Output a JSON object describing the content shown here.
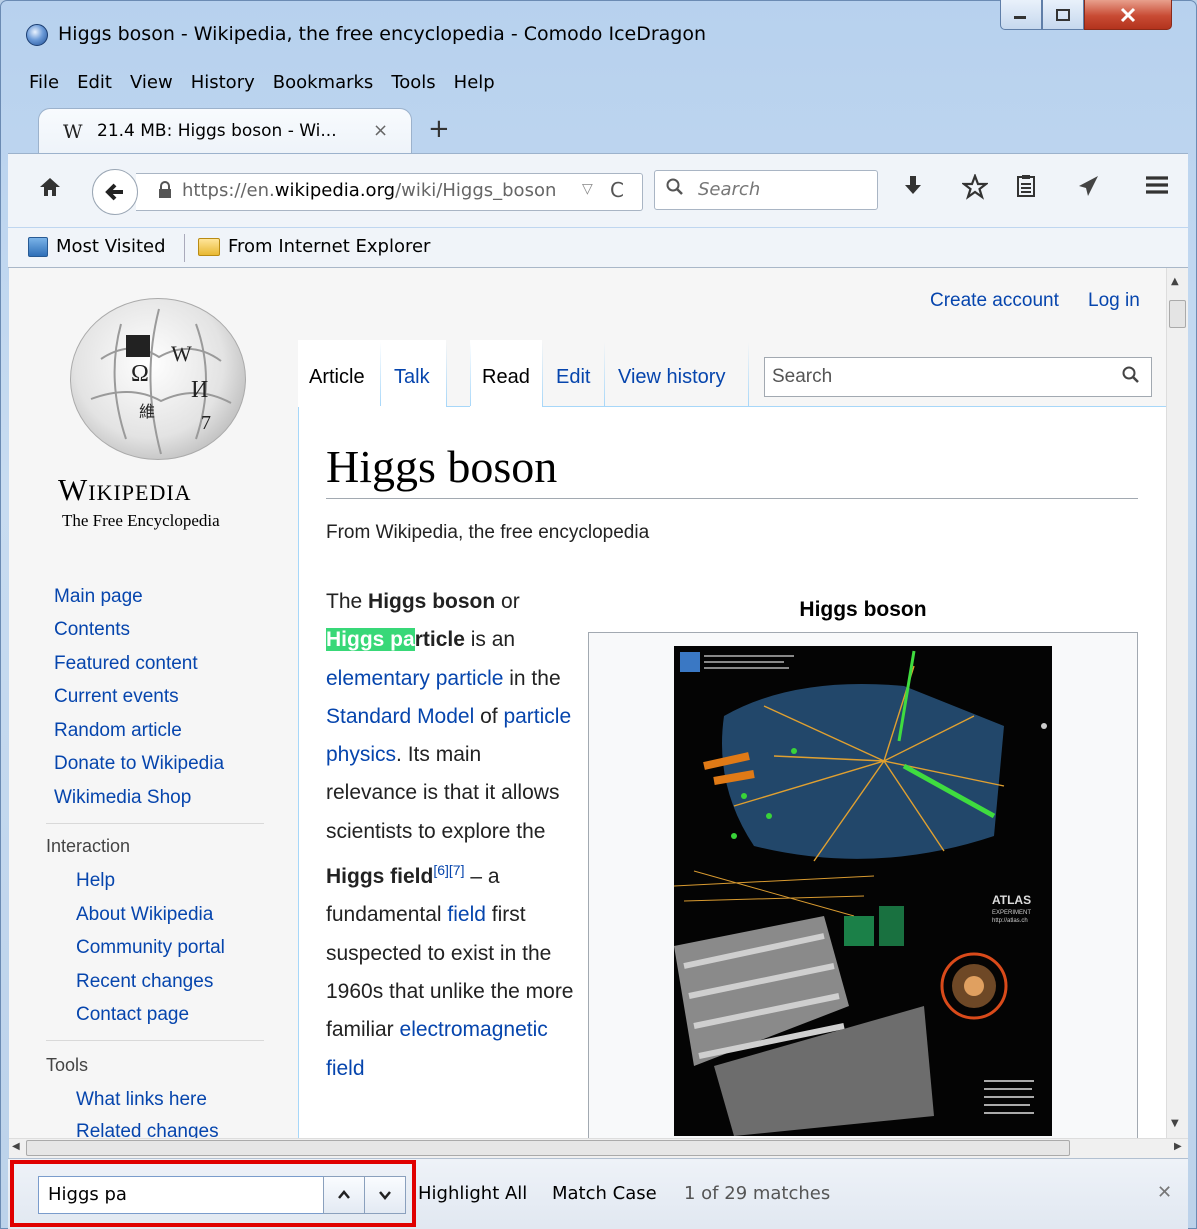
{
  "window": {
    "title": "Higgs boson - Wikipedia, the free encyclopedia - Comodo IceDragon"
  },
  "menu": [
    "File",
    "Edit",
    "View",
    "History",
    "Bookmarks",
    "Tools",
    "Help"
  ],
  "tab": {
    "favicon": "W",
    "label": "21.4 MB: Higgs boson - Wi...",
    "close": "×"
  },
  "new_tab": "+",
  "navbar": {
    "url_prefix": "https://en.",
    "url_domain": "wikipedia.org",
    "url_path": "/wiki/Higgs_boson",
    "search_placeholder": "Search",
    "icons": [
      "home-icon",
      "back-icon",
      "lock-icon",
      "reload-icon",
      "download-icon",
      "bookmark-star-icon",
      "reader-icon",
      "send-icon",
      "menu-icon"
    ]
  },
  "bookmarks": [
    "Most Visited",
    "From Internet Explorer"
  ],
  "wiki": {
    "wordmark": "Wikipedia",
    "tagline": "The Free Encyclopedia",
    "user_links": [
      "Create account",
      "Log in"
    ],
    "page_tabs": [
      "Article",
      "Talk",
      "Read",
      "Edit",
      "View history"
    ],
    "search_placeholder": "Search",
    "nav_links": [
      "Main page",
      "Contents",
      "Featured content",
      "Current events",
      "Random article",
      "Donate to Wikipedia",
      "Wikimedia Shop"
    ],
    "interaction_heading": "Interaction",
    "interaction_links": [
      "Help",
      "About Wikipedia",
      "Community portal",
      "Recent changes",
      "Contact page"
    ],
    "tools_heading": "Tools",
    "tools_links": [
      "What links here",
      "Related changes"
    ],
    "title": "Higgs boson",
    "from": "From Wikipedia, the free encyclopedia",
    "infobox_title": "Higgs boson",
    "infobox_image_labels": [
      "ATLAS",
      "EXPERIMENT",
      "http://atlas.ch"
    ],
    "para": {
      "t1": "The ",
      "b1": "Higgs boson",
      "t2": " or ",
      "hl": "Higgs pa",
      "b2": "rticle",
      "t3": " is an ",
      "l1": "elementary particle",
      "t4": " in the ",
      "l2": "Standard Model",
      "t5": " of ",
      "l3": "particle physics",
      "t6": ". Its main relevance is that it allows scientists to explore the ",
      "b3": "Higgs field",
      "sup": "[6][7]",
      "t7": " – a fundamental ",
      "l4": "field",
      "t8": " first suspected to exist in the 1960s that unlike the more familiar ",
      "l5": "electromagnetic field"
    }
  },
  "findbar": {
    "query": "Higgs pa",
    "highlight_all": "Highlight All",
    "match_case": "Match Case",
    "status": "1 of 29 matches"
  }
}
